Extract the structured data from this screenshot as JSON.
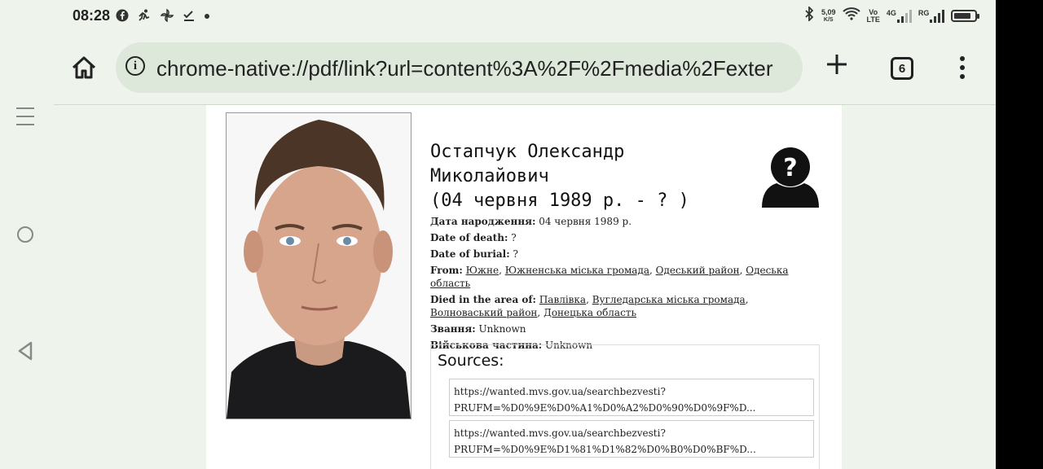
{
  "status_bar": {
    "time": "08:28",
    "left_icons": [
      "facebook-icon",
      "activity-icon",
      "pinwheel-icon",
      "check-icon",
      "dot-icon"
    ],
    "net_speed_value": "5,09",
    "net_speed_unit": "K/S",
    "volte_top": "Vo",
    "volte_bottom": "LTE",
    "net_type": "4G",
    "carrier_tag": "RG"
  },
  "browser": {
    "url": "chrome-native://pdf/link?url=content%3A%2F%2Fmedia%2Fexter",
    "tab_count": "6"
  },
  "profile": {
    "name_line1": "Остапчук Олександр",
    "name_line2": "Миколайович",
    "name_line3": "(04 червня 1989 р. - ? )",
    "birth_label": "Дата народження:",
    "birth_value": " 04 червня 1989 р.",
    "death_label": "Date of death:",
    "death_value": " ?",
    "burial_label": "Date of burial:",
    "burial_value": " ?",
    "from_label": "From:",
    "from_links": [
      "Южне",
      "Южненська міська громада",
      "Одеський район",
      "Одеська область"
    ],
    "died_label": "Died in the area of:",
    "died_links": [
      "Павлівка",
      "Вугледарська міська громада",
      "Волноваський район",
      "Донецька область"
    ],
    "rank_label": "Звання:",
    "rank_value": " Unknown",
    "unit_label": "Військова частина:",
    "unit_value": " Unknown"
  },
  "sources": {
    "title": "Sources:",
    "items": [
      {
        "line1": "https://wanted.mvs.gov.ua/searchbezvesti?",
        "line2": "PRUFM=%D0%9E%D0%A1%D0%A2%D0%90%D0%9F%D..."
      },
      {
        "line1": "https://wanted.mvs.gov.ua/searchbezvesti?",
        "line2": "PRUFM=%D0%9E%D1%81%D1%82%D0%B0%D0%BF%D..."
      }
    ]
  },
  "colors": {
    "background": "#eef4ec",
    "urlbar": "#dde7da",
    "page": "#ffffff",
    "text": "#222222"
  }
}
